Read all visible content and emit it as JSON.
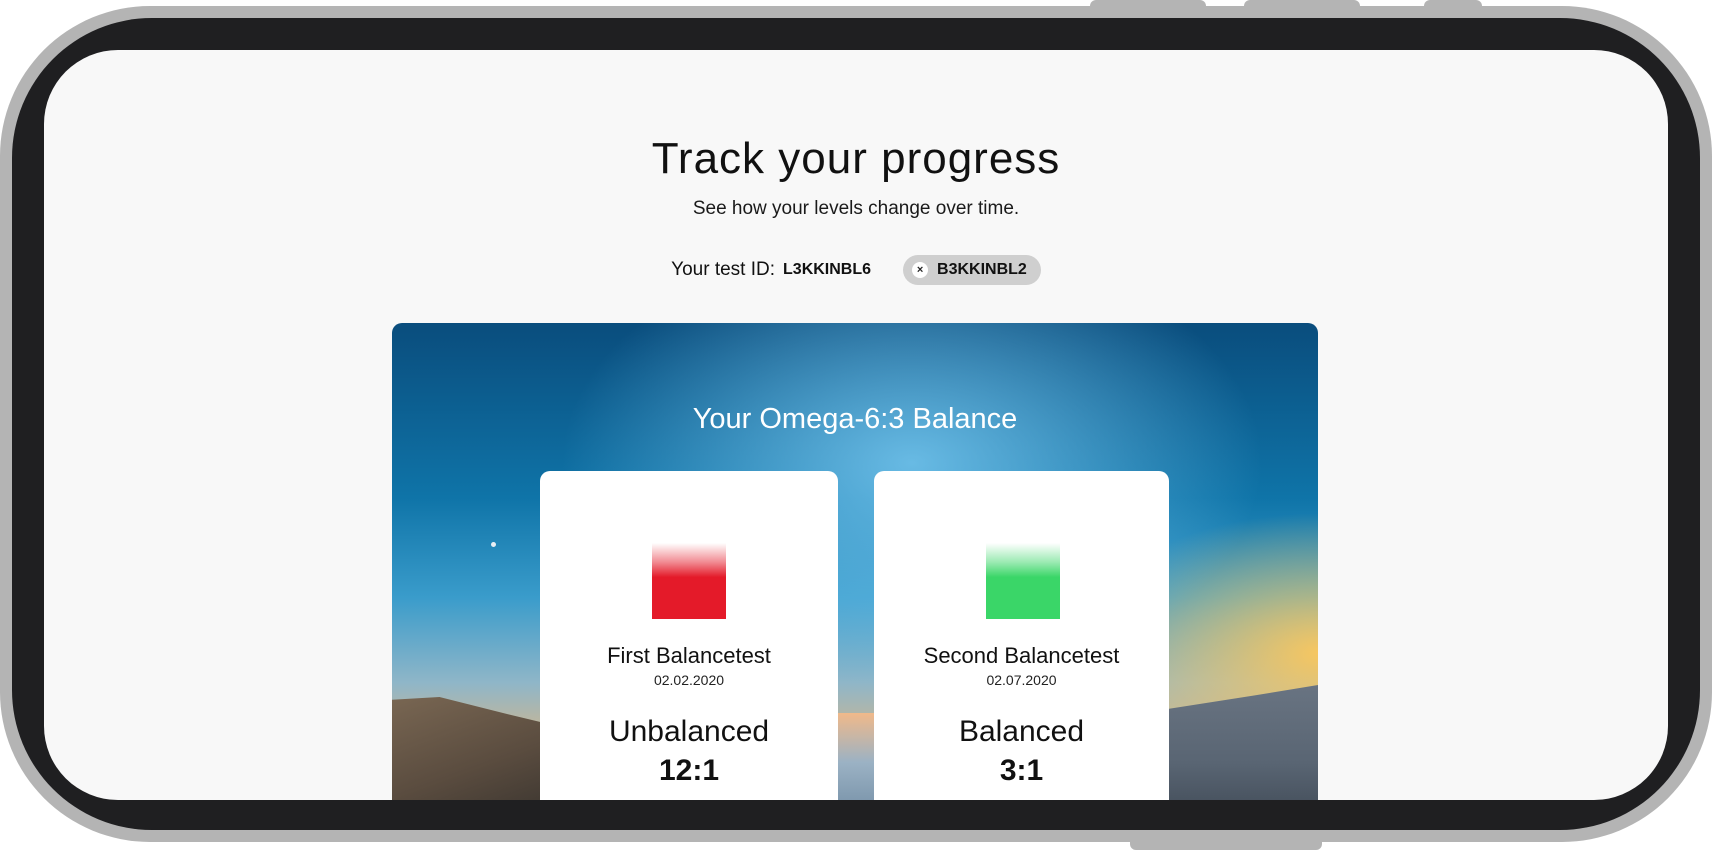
{
  "header": {
    "title": "Track your progress",
    "subtitle": "See how your levels change over time."
  },
  "test_ids": {
    "label": "Your test ID:",
    "current_id": "L3KKINBL6",
    "compare_chip": {
      "remove_icon": "×",
      "id": "B3KKINBL2"
    }
  },
  "balance_section": {
    "title": "Your Omega-6:3 Balance",
    "cards": [
      {
        "name": "First Balancetest",
        "date": "02.02.2020",
        "status": "Unbalanced",
        "ratio": "12:1",
        "color": "#e41a29"
      },
      {
        "name": "Second Balancetest",
        "date": "02.07.2020",
        "status": "Balanced",
        "ratio": "3:1",
        "color": "#3ad668"
      }
    ]
  }
}
